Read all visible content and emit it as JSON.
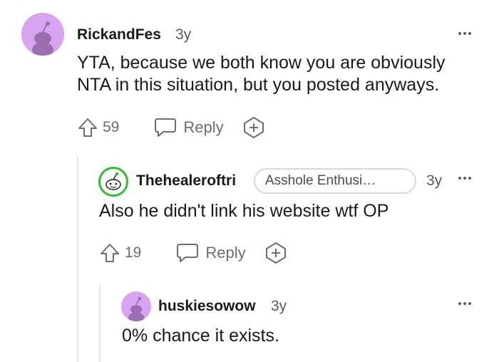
{
  "comments": [
    {
      "username": "RickandFes",
      "age": "3y",
      "body_lines": [
        "YTA, because we both know you are obviously",
        "NTA in this situation, but you posted anyways."
      ],
      "votes": "59",
      "reply_label": "Reply",
      "avatar_color": "#d8a3f0"
    },
    {
      "username": "Thehealeroftri",
      "flair": "Asshole Enthusi…",
      "age": "3y",
      "body": "Also he didn't link his website wtf OP",
      "votes": "19",
      "reply_label": "Reply",
      "avatar_color": "#2ec02e"
    },
    {
      "username": "huskiesowow",
      "age": "3y",
      "body": "0% chance it exists.",
      "avatar_color": "#d8a3f0"
    }
  ],
  "colors": {
    "muted_icon": "#6a6e72",
    "thread_line": "#e2e4e6"
  }
}
